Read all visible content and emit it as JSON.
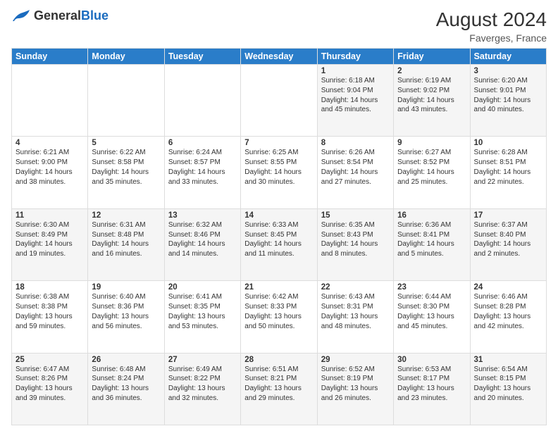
{
  "header": {
    "logo_general": "General",
    "logo_blue": "Blue",
    "month_year": "August 2024",
    "location": "Faverges, France"
  },
  "weekdays": [
    "Sunday",
    "Monday",
    "Tuesday",
    "Wednesday",
    "Thursday",
    "Friday",
    "Saturday"
  ],
  "weeks": [
    [
      {
        "day": "",
        "info": ""
      },
      {
        "day": "",
        "info": ""
      },
      {
        "day": "",
        "info": ""
      },
      {
        "day": "",
        "info": ""
      },
      {
        "day": "1",
        "info": "Sunrise: 6:18 AM\nSunset: 9:04 PM\nDaylight: 14 hours\nand 45 minutes."
      },
      {
        "day": "2",
        "info": "Sunrise: 6:19 AM\nSunset: 9:02 PM\nDaylight: 14 hours\nand 43 minutes."
      },
      {
        "day": "3",
        "info": "Sunrise: 6:20 AM\nSunset: 9:01 PM\nDaylight: 14 hours\nand 40 minutes."
      }
    ],
    [
      {
        "day": "4",
        "info": "Sunrise: 6:21 AM\nSunset: 9:00 PM\nDaylight: 14 hours\nand 38 minutes."
      },
      {
        "day": "5",
        "info": "Sunrise: 6:22 AM\nSunset: 8:58 PM\nDaylight: 14 hours\nand 35 minutes."
      },
      {
        "day": "6",
        "info": "Sunrise: 6:24 AM\nSunset: 8:57 PM\nDaylight: 14 hours\nand 33 minutes."
      },
      {
        "day": "7",
        "info": "Sunrise: 6:25 AM\nSunset: 8:55 PM\nDaylight: 14 hours\nand 30 minutes."
      },
      {
        "day": "8",
        "info": "Sunrise: 6:26 AM\nSunset: 8:54 PM\nDaylight: 14 hours\nand 27 minutes."
      },
      {
        "day": "9",
        "info": "Sunrise: 6:27 AM\nSunset: 8:52 PM\nDaylight: 14 hours\nand 25 minutes."
      },
      {
        "day": "10",
        "info": "Sunrise: 6:28 AM\nSunset: 8:51 PM\nDaylight: 14 hours\nand 22 minutes."
      }
    ],
    [
      {
        "day": "11",
        "info": "Sunrise: 6:30 AM\nSunset: 8:49 PM\nDaylight: 14 hours\nand 19 minutes."
      },
      {
        "day": "12",
        "info": "Sunrise: 6:31 AM\nSunset: 8:48 PM\nDaylight: 14 hours\nand 16 minutes."
      },
      {
        "day": "13",
        "info": "Sunrise: 6:32 AM\nSunset: 8:46 PM\nDaylight: 14 hours\nand 14 minutes."
      },
      {
        "day": "14",
        "info": "Sunrise: 6:33 AM\nSunset: 8:45 PM\nDaylight: 14 hours\nand 11 minutes."
      },
      {
        "day": "15",
        "info": "Sunrise: 6:35 AM\nSunset: 8:43 PM\nDaylight: 14 hours\nand 8 minutes."
      },
      {
        "day": "16",
        "info": "Sunrise: 6:36 AM\nSunset: 8:41 PM\nDaylight: 14 hours\nand 5 minutes."
      },
      {
        "day": "17",
        "info": "Sunrise: 6:37 AM\nSunset: 8:40 PM\nDaylight: 14 hours\nand 2 minutes."
      }
    ],
    [
      {
        "day": "18",
        "info": "Sunrise: 6:38 AM\nSunset: 8:38 PM\nDaylight: 13 hours\nand 59 minutes."
      },
      {
        "day": "19",
        "info": "Sunrise: 6:40 AM\nSunset: 8:36 PM\nDaylight: 13 hours\nand 56 minutes."
      },
      {
        "day": "20",
        "info": "Sunrise: 6:41 AM\nSunset: 8:35 PM\nDaylight: 13 hours\nand 53 minutes."
      },
      {
        "day": "21",
        "info": "Sunrise: 6:42 AM\nSunset: 8:33 PM\nDaylight: 13 hours\nand 50 minutes."
      },
      {
        "day": "22",
        "info": "Sunrise: 6:43 AM\nSunset: 8:31 PM\nDaylight: 13 hours\nand 48 minutes."
      },
      {
        "day": "23",
        "info": "Sunrise: 6:44 AM\nSunset: 8:30 PM\nDaylight: 13 hours\nand 45 minutes."
      },
      {
        "day": "24",
        "info": "Sunrise: 6:46 AM\nSunset: 8:28 PM\nDaylight: 13 hours\nand 42 minutes."
      }
    ],
    [
      {
        "day": "25",
        "info": "Sunrise: 6:47 AM\nSunset: 8:26 PM\nDaylight: 13 hours\nand 39 minutes."
      },
      {
        "day": "26",
        "info": "Sunrise: 6:48 AM\nSunset: 8:24 PM\nDaylight: 13 hours\nand 36 minutes."
      },
      {
        "day": "27",
        "info": "Sunrise: 6:49 AM\nSunset: 8:22 PM\nDaylight: 13 hours\nand 32 minutes."
      },
      {
        "day": "28",
        "info": "Sunrise: 6:51 AM\nSunset: 8:21 PM\nDaylight: 13 hours\nand 29 minutes."
      },
      {
        "day": "29",
        "info": "Sunrise: 6:52 AM\nSunset: 8:19 PM\nDaylight: 13 hours\nand 26 minutes."
      },
      {
        "day": "30",
        "info": "Sunrise: 6:53 AM\nSunset: 8:17 PM\nDaylight: 13 hours\nand 23 minutes."
      },
      {
        "day": "31",
        "info": "Sunrise: 6:54 AM\nSunset: 8:15 PM\nDaylight: 13 hours\nand 20 minutes."
      }
    ]
  ]
}
